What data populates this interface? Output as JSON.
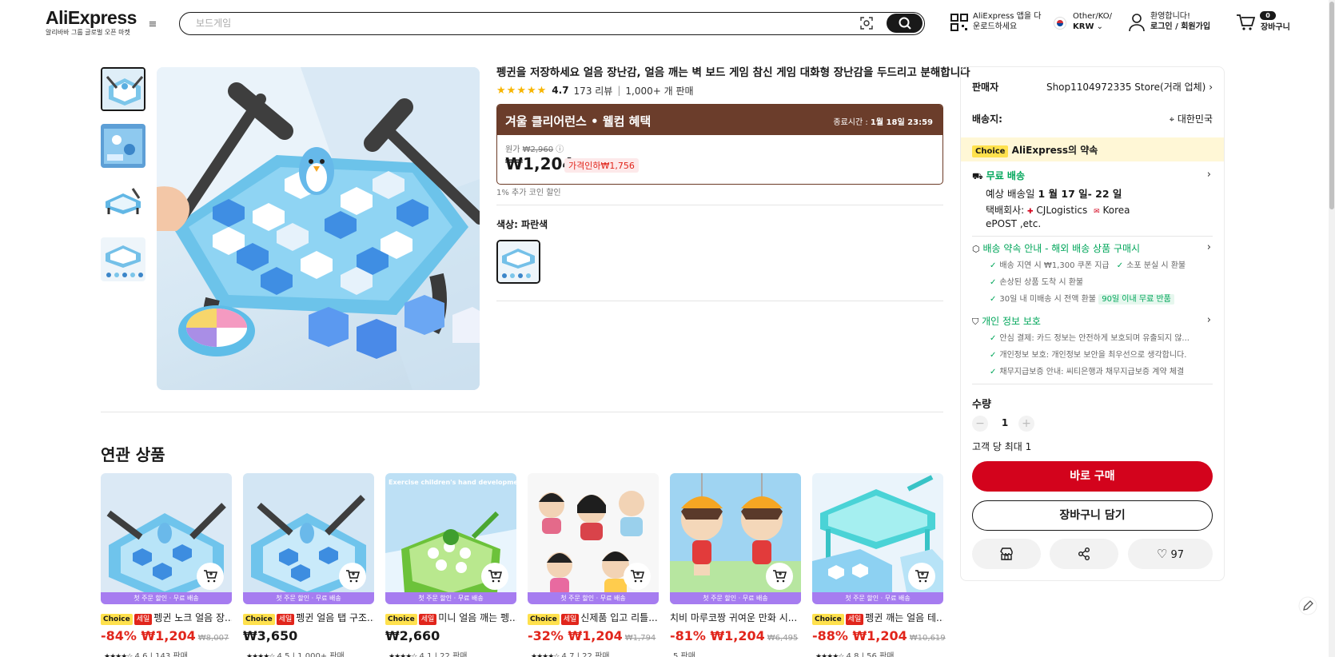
{
  "header": {
    "logo": "AliExpress",
    "logo_sub": "알리바바 그룹 글로벌 오픈 마켓",
    "search_placeholder": "보드게임",
    "app_download_line1": "AliExpress 앱을 다",
    "app_download_line2": "운로드하세요",
    "region_line1": "Other/KO/",
    "region_line2": "KRW",
    "account_line1": "환영합니다!",
    "account_line2": "로그인 / 회원가입",
    "cart_count": "0",
    "cart_label": "장바구니"
  },
  "product": {
    "title": "펭귄을 저장하세요 얼음 장난감, 얼음 깨는 벽 보드 게임 참신 게임 대화형 장난감을 두드리고 분해합니다",
    "rating": "4.7",
    "reviews": "173 리뷰",
    "sold": "1,000+ 개 판매",
    "promo_title": "겨울 클리어런스 • 웰컴 혜택",
    "promo_end_label": "종료시간 :",
    "promo_end_time": "1월 18일 23:59",
    "orig_label": "원가",
    "orig_price": "₩2,960",
    "price": "₩1,204",
    "discount": "가격인하₩1,756",
    "coin_note": "1% 추가 코인 할인",
    "color_label": "색상: 파란색"
  },
  "panel": {
    "seller_label": "판매자",
    "seller_value": "Shop1104972335 Store(거래 업체)",
    "ship_to_label": "배송지:",
    "ship_to_value": "대한민국",
    "choice_tag": "Choice",
    "choice_text": "AliExpress의 약속",
    "free_shipping": "무료 배송",
    "delivery_prefix": "예상 배송일",
    "delivery_date": "1 월 17 일- 22 일",
    "carrier_label": "택배회사:",
    "carrier_1": "CJLogistics",
    "carrier_2": "Korea",
    "carrier_3": "ePOST ,etc.",
    "promise_title": "배송 약속 안내 - 해외 배송 상품 구매시",
    "promise_1": "배송 지연 시 ₩1,300 쿠폰 지급",
    "promise_2": "소포 분실 시 환불",
    "promise_3": "손상된 상품 도착 시 환불",
    "promise_4": "30일 내 미배송 시 전액 환불",
    "promise_badge": "90일 이내 무료 반품",
    "privacy_title": "개인 정보 보호",
    "privacy_1": "안심 결제: 카드 정보는 안전하게 보호되며 유출되지 않...",
    "privacy_2": "개인정보 보호: 개인정보 보안을 최우선으로 생각합니다.",
    "privacy_3": "채무지급보증 안내: 씨티은행과 채무지급보증 계약 체결",
    "qty_label": "수량",
    "qty_value": "1",
    "qty_limit": "고객 당 최대 1",
    "buy_now": "바로 구매",
    "add_cart": "장바구니 담기",
    "wish_count": "97"
  },
  "related": {
    "title": "연관 상품",
    "band": "첫 주문 할인 · 무료 배송",
    "choice": "Choice",
    "sale": "세일",
    "items": [
      {
        "name": "펭귄 노크 얼음 장...",
        "off": "-84%",
        "price": "₩1,204",
        "orig": "₩8,007",
        "rating": "4.6",
        "sold": "143 판매"
      },
      {
        "name": "펭귄 얼음 탭 구조...",
        "off": "",
        "price": "₩3,650",
        "orig": "",
        "rating": "4.5",
        "sold": "1,000+ 판매"
      },
      {
        "name": "미니 얼음 깨는 펭...",
        "off": "",
        "price": "₩2,660",
        "orig": "",
        "rating": "4.1",
        "sold": "22 판매"
      },
      {
        "name": "신제품 입고 리틀...",
        "off": "-32%",
        "price": "₩1,204",
        "orig": "₩1,794",
        "rating": "4.7",
        "sold": "22 판매"
      },
      {
        "name": "치비 마루코짱 귀여운 만화 시...",
        "off": "-81%",
        "price": "₩1,204",
        "orig": "₩6,495",
        "rating": "",
        "sold": "5 판매"
      },
      {
        "name": "펭귄 깨는 얼음 테...",
        "off": "-88%",
        "price": "₩1,204",
        "orig": "₩10,619",
        "rating": "4.8",
        "sold": "56 판매"
      }
    ],
    "img3_text": "Exercise children's hand development"
  },
  "colors": {
    "accent_red": "#d3031c",
    "promo_brown": "#6b3d2b",
    "green": "#00a65a",
    "choice_yellow": "#ffe14d"
  }
}
